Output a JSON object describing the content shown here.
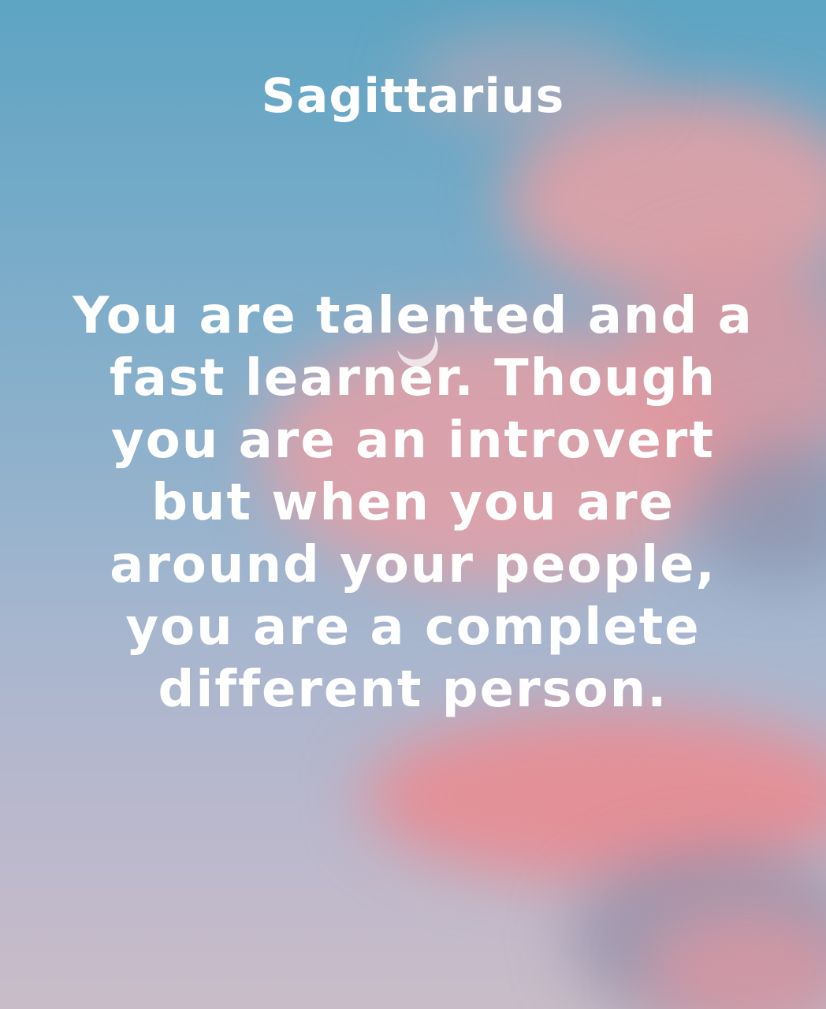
{
  "title": "Sagittarius",
  "quote_lines": [
    "You are talented and a",
    "fast learner. Though",
    "you are an introvert",
    "but when you are",
    "around your people,",
    "you are a complete",
    "different person."
  ],
  "colors": {
    "sky_top": "#5ea4c3",
    "sky_bottom": "#c9bcc8",
    "cloud_pink": "#e99a9c",
    "text": "#ffffff"
  }
}
